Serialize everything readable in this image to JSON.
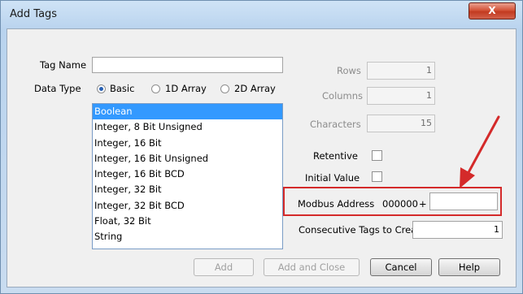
{
  "window": {
    "title": "Add Tags",
    "close_glyph": "X"
  },
  "form": {
    "tag_name_label": "Tag Name",
    "tag_name_value": "",
    "data_type_label": "Data Type",
    "radio_basic": "Basic",
    "radio_1d": "1D Array",
    "radio_2d": "2D Array",
    "selected_data_type": "Basic",
    "type_list": [
      "Boolean",
      "Integer, 8 Bit Unsigned",
      "Integer, 16 Bit",
      "Integer, 16 Bit Unsigned",
      "Integer, 16 Bit BCD",
      "Integer, 32 Bit",
      "Integer, 32 Bit BCD",
      "Float, 32 Bit",
      "String"
    ],
    "selected_type": "Boolean",
    "rows_label": "Rows",
    "rows_value": "1",
    "columns_label": "Columns",
    "columns_value": "1",
    "characters_label": "Characters",
    "characters_value": "15",
    "retentive_label": "Retentive",
    "initial_value_label": "Initial Value",
    "modbus_label": "Modbus Address",
    "modbus_prefix": "000000",
    "modbus_plus": "+",
    "modbus_value": "",
    "consecutive_label": "Consecutive Tags to Create",
    "consecutive_value": "1"
  },
  "buttons": {
    "add": "Add",
    "add_close": "Add and Close",
    "cancel": "Cancel",
    "help": "Help"
  },
  "colors": {
    "annotation_red": "#d42a2a",
    "selection_blue": "#3399ff"
  }
}
